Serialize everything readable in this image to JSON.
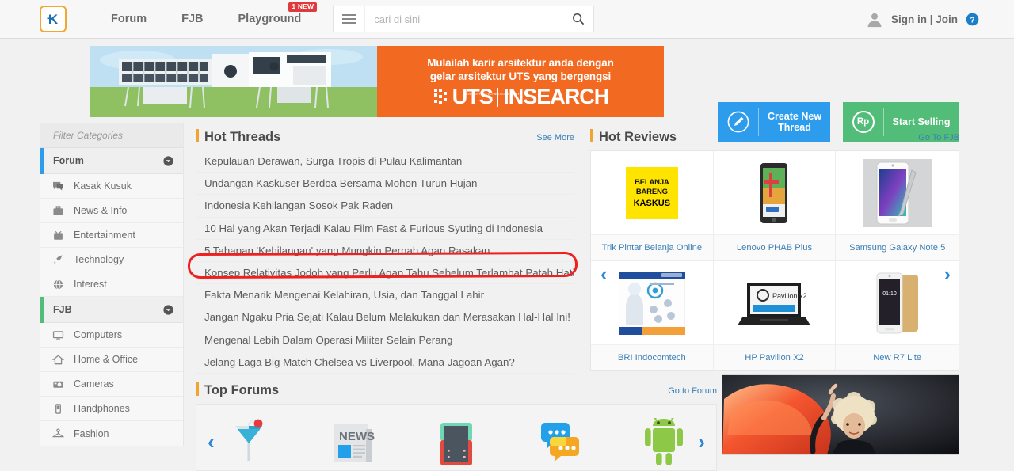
{
  "header": {
    "logo_alt": "kaskus-logo",
    "nav": [
      {
        "label": "Forum",
        "badge": null
      },
      {
        "label": "FJB",
        "badge": null
      },
      {
        "label": "Playground",
        "badge": "1 NEW"
      }
    ],
    "search": {
      "value": "",
      "placeholder": "cari di sini"
    },
    "account": {
      "signin_label": "Sign in | Join"
    }
  },
  "ad_banner": {
    "line1": "Mulailah karir arsitektur anda dengan",
    "line2": "gelar arsitektur UTS yang bergengsi",
    "brand": "UTS",
    "brand2": "INSEARCH",
    "brand_sub": "UNIVERSITY OF TECHNOLOGY SYDNEY"
  },
  "actions": {
    "create_thread": "Create New Thread",
    "start_selling": "Start Selling",
    "rp_symbol": "Rp"
  },
  "sidebar": {
    "filter_placeholder": "Filter Categories",
    "filter_value": "",
    "groups": [
      {
        "label": "Forum",
        "accent": "#2e9ced",
        "items": [
          {
            "label": "Kasak Kusuk",
            "icon": "chat-icon"
          },
          {
            "label": "News & Info",
            "icon": "briefcase-icon"
          },
          {
            "label": "Entertainment",
            "icon": "tv-icon"
          },
          {
            "label": "Technology",
            "icon": "rocket-icon"
          },
          {
            "label": "Interest",
            "icon": "globe-icon"
          }
        ]
      },
      {
        "label": "FJB",
        "accent": "#52bd78",
        "items": [
          {
            "label": "Computers",
            "icon": "monitor-icon"
          },
          {
            "label": "Home & Office",
            "icon": "home-icon"
          },
          {
            "label": "Cameras",
            "icon": "camera-icon"
          },
          {
            "label": "Handphones",
            "icon": "phone-icon"
          },
          {
            "label": "Fashion",
            "icon": "hanger-icon"
          }
        ]
      }
    ]
  },
  "hot_threads": {
    "title": "Hot Threads",
    "see_more": "See More",
    "highlighted_index": 5,
    "items": [
      "Kepulauan Derawan, Surga Tropis di Pulau Kalimantan",
      "Undangan Kaskuser Berdoa Bersama Mohon Turun Hujan",
      "Indonesia Kehilangan Sosok Pak Raden",
      "10 Hal yang Akan Terjadi Kalau Film Fast & Furious Syuting di Indonesia",
      "5 Tahapan 'Kehilangan' yang Mungkin Pernah Agan Rasakan",
      "Konsep Relativitas Jodoh yang Perlu Agan Tahu Sebelum Terlambat Patah Hati",
      "Fakta Menarik Mengenai Kelahiran, Usia, dan Tanggal Lahir",
      "Jangan Ngaku Pria Sejati Kalau Belum Melakukan dan Merasakan Hal-Hal Ini!",
      "Mengenal Lebih Dalam Operasi Militer Selain Perang",
      "Jelang Laga Big Match Chelsea vs Liverpool, Mana Jagoan Agan?"
    ]
  },
  "hot_reviews": {
    "title": "Hot Reviews",
    "go_link": "Go To FJB",
    "prev_arrow": "‹",
    "next_arrow": "›",
    "items": [
      {
        "caption": "Trik Pintar Belanja Online",
        "thumb": "belanja-bareng-kaskus",
        "t1": "BELANJA",
        "t2": "BARENG",
        "t3": "KASKUS"
      },
      {
        "caption": "Lenovo PHAB Plus",
        "thumb": "tablet-thumb"
      },
      {
        "caption": "Samsung Galaxy Note 5",
        "thumb": "note5-thumb"
      },
      {
        "caption": "BRI Indocomtech",
        "thumb": "bri-thumb"
      },
      {
        "caption": "HP Pavilion X2",
        "thumb": "laptop-thumb"
      },
      {
        "caption": "New R7 Lite",
        "thumb": "r7lite-thumb"
      }
    ]
  },
  "top_forums": {
    "title": "Top Forums",
    "go_link": "Go to Forum",
    "prev_arrow": "‹",
    "next_arrow": "›",
    "items": [
      {
        "icon": "cocktail-icon"
      },
      {
        "icon": "news-icon",
        "label": "NEWS"
      },
      {
        "icon": "handheld-console-icon"
      },
      {
        "icon": "chat-bubbles-icon"
      },
      {
        "icon": "android-icon"
      }
    ]
  },
  "fashion_ad": {
    "alt": "fashion-model-ad"
  }
}
